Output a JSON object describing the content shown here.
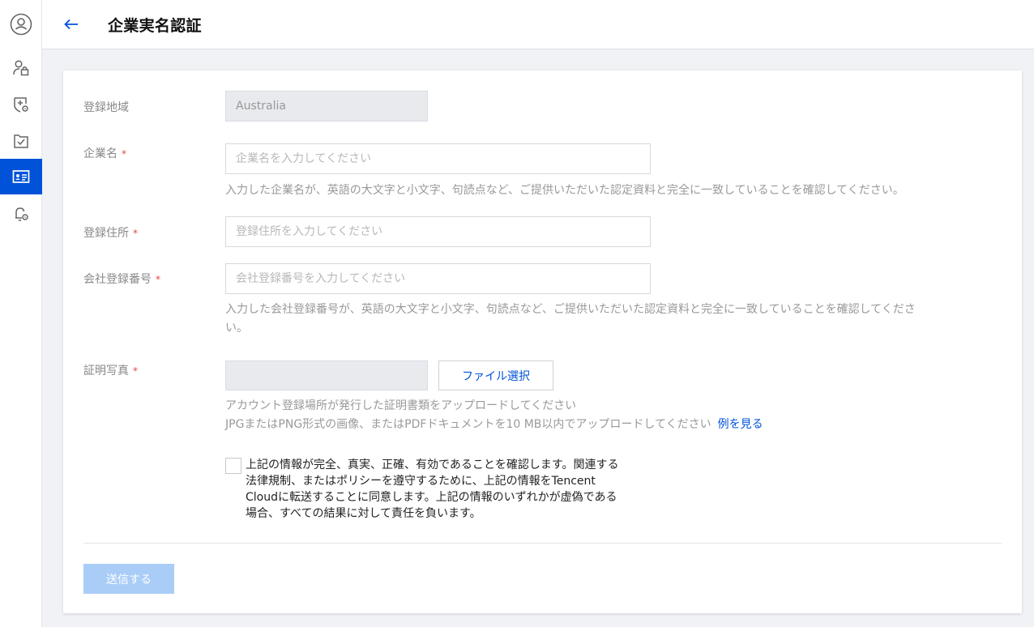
{
  "header": {
    "back_icon": "arrow-left-icon",
    "title": "企業実名認証"
  },
  "sidebar": {
    "items": [
      {
        "icon": "user-circle-icon",
        "active": false
      },
      {
        "icon": "user-lock-icon",
        "active": false
      },
      {
        "icon": "shield-settings-icon",
        "active": false
      },
      {
        "icon": "folder-check-icon",
        "active": false
      },
      {
        "icon": "id-card-icon",
        "active": true
      },
      {
        "icon": "bell-settings-icon",
        "active": false
      }
    ]
  },
  "form": {
    "region": {
      "label": "登録地域",
      "value": "Australia"
    },
    "company_name": {
      "label": "企業名",
      "required_mark": "*",
      "placeholder": "企業名を入力してください",
      "hint": "入力した企業名が、英語の大文字と小文字、句読点など、ご提供いただいた認定資料と完全に一致していることを確認してください。"
    },
    "address": {
      "label": "登録住所",
      "required_mark": "*",
      "placeholder": "登録住所を入力してください"
    },
    "registration_number": {
      "label": "会社登録番号",
      "required_mark": "*",
      "placeholder": "会社登録番号を入力してください",
      "hint_line1": "入力した会社登録番号が、英語の大文字と小文字、句読点など、ご提供いただいた認定資料と完全に一致していることを確認してくださ",
      "hint_line2": "い。"
    },
    "certificate": {
      "label": "証明写真",
      "required_mark": "*",
      "file_button": "ファイル選択",
      "hint_line1": "アカウント登録場所が発行した証明書類をアップロードしてください",
      "hint_line2": "JPGまたはPNG形式の画像、またはPDFドキュメントを10 MB以内でアップロードしてください",
      "example_link": "例を見る"
    },
    "agreement": {
      "checked": false,
      "line1": "上記の情報が完全、真実、正確、有効であることを確認します。関連する",
      "line2": "法律規制、またはポリシーを遵守するために、上記の情報をTencent",
      "line3": "Cloudに転送することに同意します。上記の情報のいずれかが虚偽である",
      "line4": "場合、すべての結果に対して責任を負います。"
    },
    "submit_label": "送信する"
  },
  "colors": {
    "accent": "#0052d9",
    "required": "#e54545",
    "submit_disabled": "#a9cdf7"
  }
}
